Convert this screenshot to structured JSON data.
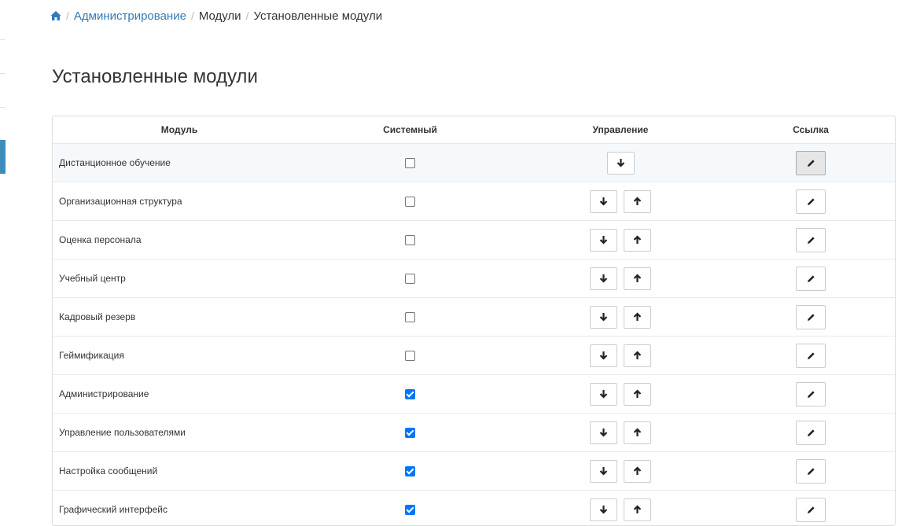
{
  "breadcrumb": {
    "home_icon": "home-icon",
    "items": [
      "Администрирование",
      "Модули",
      "Установленные модули"
    ]
  },
  "page": {
    "title": "Установленные модули"
  },
  "table": {
    "headers": {
      "module": "Модуль",
      "system": "Системный",
      "manage": "Управление",
      "link": "Ссылка"
    },
    "rows": [
      {
        "name": "Дистанционное обучение",
        "system": false
      },
      {
        "name": "Организационная структура",
        "system": false
      },
      {
        "name": "Оценка персонала",
        "system": false
      },
      {
        "name": "Учебный центр",
        "system": false
      },
      {
        "name": "Кадровый резерв",
        "system": false
      },
      {
        "name": "Геймификация",
        "system": false
      },
      {
        "name": "Администрирование",
        "system": true
      },
      {
        "name": "Управление пользователями",
        "system": true
      },
      {
        "name": "Настройка сообщений",
        "system": true
      },
      {
        "name": "Графический интерфейс",
        "system": true
      }
    ]
  },
  "icons": {
    "down": "arrow-down-icon",
    "up": "arrow-up-icon",
    "edit": "pencil-icon"
  },
  "colors": {
    "link": "#337ab7",
    "checkbox": "#0075ff",
    "sidebar_active": "#3c8dbc"
  }
}
